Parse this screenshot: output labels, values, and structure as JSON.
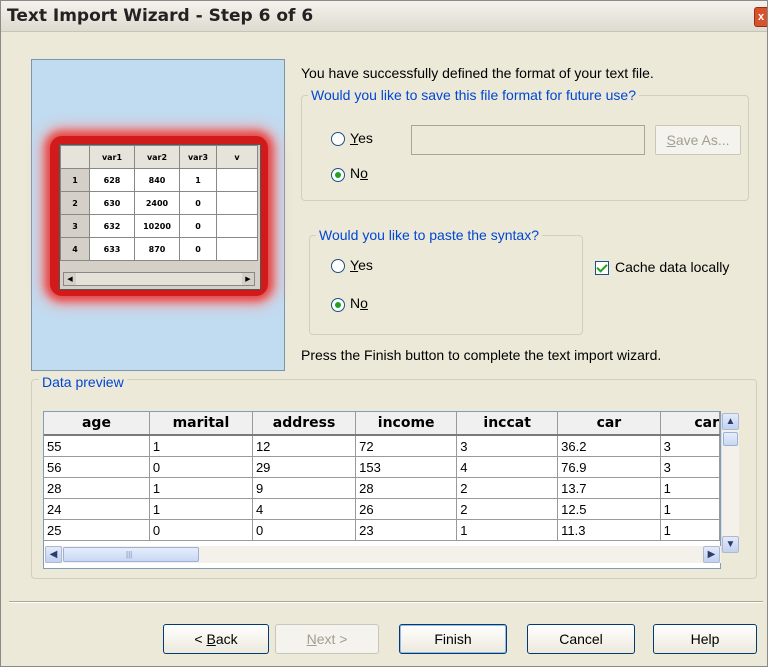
{
  "window": {
    "title": "Text Import Wizard - Step 6 of 6",
    "close_glyph": "x"
  },
  "illustration": {
    "columns": [
      "var1",
      "var2",
      "var3",
      "v"
    ],
    "rows": [
      {
        "n": "1",
        "cells": [
          "628",
          "840",
          "1",
          ""
        ]
      },
      {
        "n": "2",
        "cells": [
          "630",
          "2400",
          "0",
          ""
        ]
      },
      {
        "n": "3",
        "cells": [
          "632",
          "10200",
          "0",
          ""
        ]
      },
      {
        "n": "4",
        "cells": [
          "633",
          "870",
          "0",
          ""
        ]
      }
    ]
  },
  "intro_text": "You have successfully defined the format of your text file.",
  "save_format": {
    "legend": "Would you like to save this file format for future use?",
    "yes_label_u": "Y",
    "yes_label_rest": "es",
    "no_label_pre": "N",
    "no_label_u": "o",
    "selected": "No",
    "filename_value": "",
    "save_as_pre": "S",
    "save_as_rest": "ave As..."
  },
  "paste_syntax": {
    "legend": "Would you like to paste the syntax?",
    "yes_label_u": "Y",
    "yes_label_rest": "es",
    "no_label_pre": "N",
    "no_label_u": "o",
    "selected": "No"
  },
  "cache": {
    "label": "Cache data locally",
    "checked": true
  },
  "finish_text": "Press the Finish button to complete the text import wizard.",
  "data_preview": {
    "legend": "Data preview",
    "columns": [
      "age",
      "marital",
      "address",
      "income",
      "inccat",
      "car",
      "car"
    ],
    "rows": [
      [
        "55",
        "1",
        "12",
        "72",
        "3",
        "36.2",
        "3"
      ],
      [
        "56",
        "0",
        "29",
        "153",
        "4",
        "76.9",
        "3"
      ],
      [
        "28",
        "1",
        "9",
        "28",
        "2",
        "13.7",
        "1"
      ],
      [
        "24",
        "1",
        "4",
        "26",
        "2",
        "12.5",
        "1"
      ],
      [
        "25",
        "0",
        "0",
        "23",
        "1",
        "11.3",
        "1"
      ]
    ]
  },
  "buttons": {
    "back_pre": "< ",
    "back_u": "B",
    "back_rest": "ack",
    "next_u": "N",
    "next_rest": "ext >",
    "finish": "Finish",
    "cancel": "Cancel",
    "help": "Help"
  }
}
